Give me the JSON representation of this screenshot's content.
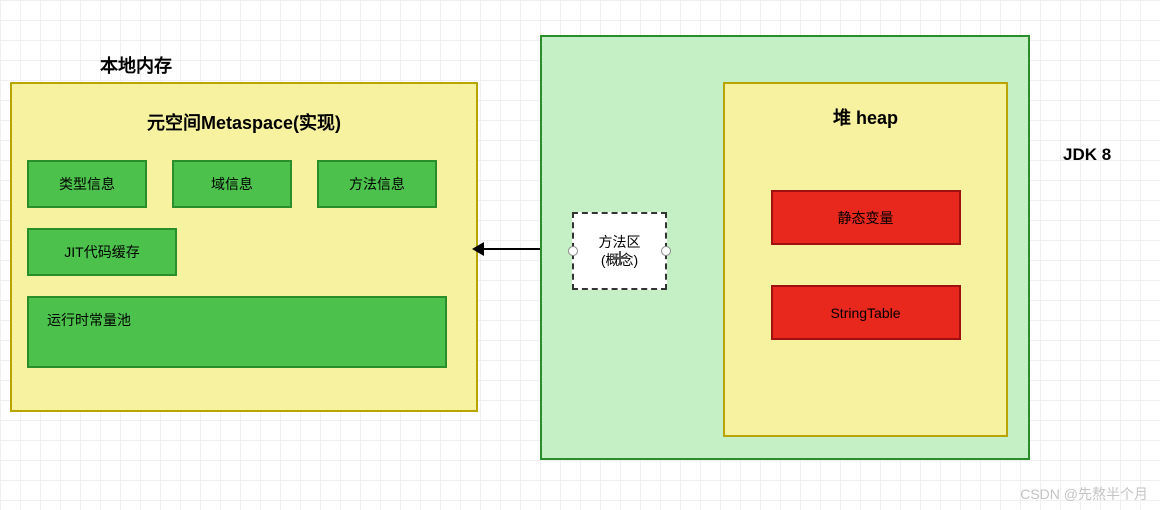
{
  "native_memory_label": "本地内存",
  "metaspace": {
    "title": "元空间Metaspace(实现)",
    "class_info": "类型信息",
    "field_info": "域信息",
    "method_info": "方法信息",
    "jit_cache": "JIT代码缓存",
    "runtime_pool": "运行时常量池"
  },
  "method_area": {
    "line1": "方法区",
    "line2": "(概念)"
  },
  "heap": {
    "title": "堆 heap",
    "static_vars": "静态变量",
    "string_table": "StringTable"
  },
  "jdk_label": "JDK 8",
  "watermark": "CSDN @先熬半个月"
}
